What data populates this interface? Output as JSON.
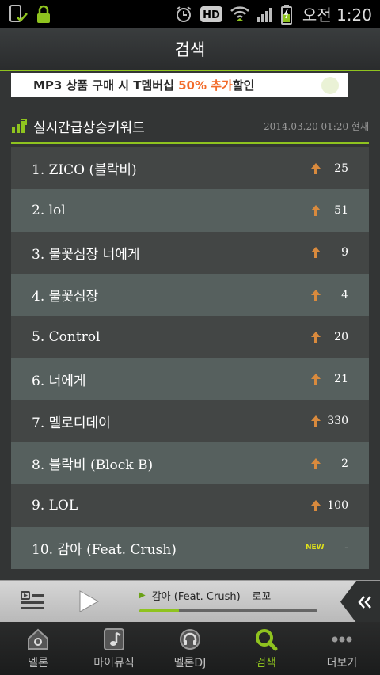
{
  "status_bar": {
    "clock": "오전 1:20",
    "hd_label": "HD",
    "icons": [
      "phone-check-icon",
      "lock-icon",
      "alarm-icon",
      "hd-icon",
      "wifi-icon",
      "signal-icon",
      "battery-icon"
    ]
  },
  "header": {
    "title": "검색"
  },
  "banner": {
    "text_before": "MP3 상품 구매 시 T멤버십 ",
    "accent": "50% 추가",
    "text_after": "할인"
  },
  "section": {
    "title": "실시간급상승키워드",
    "timestamp": "2014.03.20 01:20 현재"
  },
  "keywords": [
    {
      "label": "1. ZICO (블락비)",
      "trend": "up",
      "change": "25"
    },
    {
      "label": "2. lol",
      "trend": "up",
      "change": "51"
    },
    {
      "label": "3. 불꽃심장 너에게",
      "trend": "up",
      "change": "9"
    },
    {
      "label": "4. 불꽃심장",
      "trend": "up",
      "change": "4"
    },
    {
      "label": "5. Control",
      "trend": "up",
      "change": "20"
    },
    {
      "label": "6. 너에게",
      "trend": "up",
      "change": "21"
    },
    {
      "label": "7. 멜로디데이",
      "trend": "up",
      "change": "330"
    },
    {
      "label": "8. 블락비 (Block B)",
      "trend": "up",
      "change": "2"
    },
    {
      "label": "9. LOL",
      "trend": "up",
      "change": "100"
    },
    {
      "label": "10. 감아 (Feat. Crush)",
      "trend": "new",
      "new_label": "NEW",
      "change": "-"
    }
  ],
  "player": {
    "now_playing": "감아 (Feat. Crush) – 로꼬",
    "progress": 0.22
  },
  "bottom_nav": [
    {
      "label": "멜론",
      "icon": "home-icon",
      "active": false
    },
    {
      "label": "마이뮤직",
      "icon": "music-note-icon",
      "active": false
    },
    {
      "label": "멜론DJ",
      "icon": "headphones-icon",
      "active": false
    },
    {
      "label": "검색",
      "icon": "search-icon",
      "active": true
    },
    {
      "label": "더보기",
      "icon": "more-icon",
      "active": false
    }
  ],
  "colors": {
    "accent_green": "#8fc31f",
    "trend_up": "#d98a3d",
    "new_badge": "#e0e21a",
    "banner_accent": "#f26b2a"
  }
}
